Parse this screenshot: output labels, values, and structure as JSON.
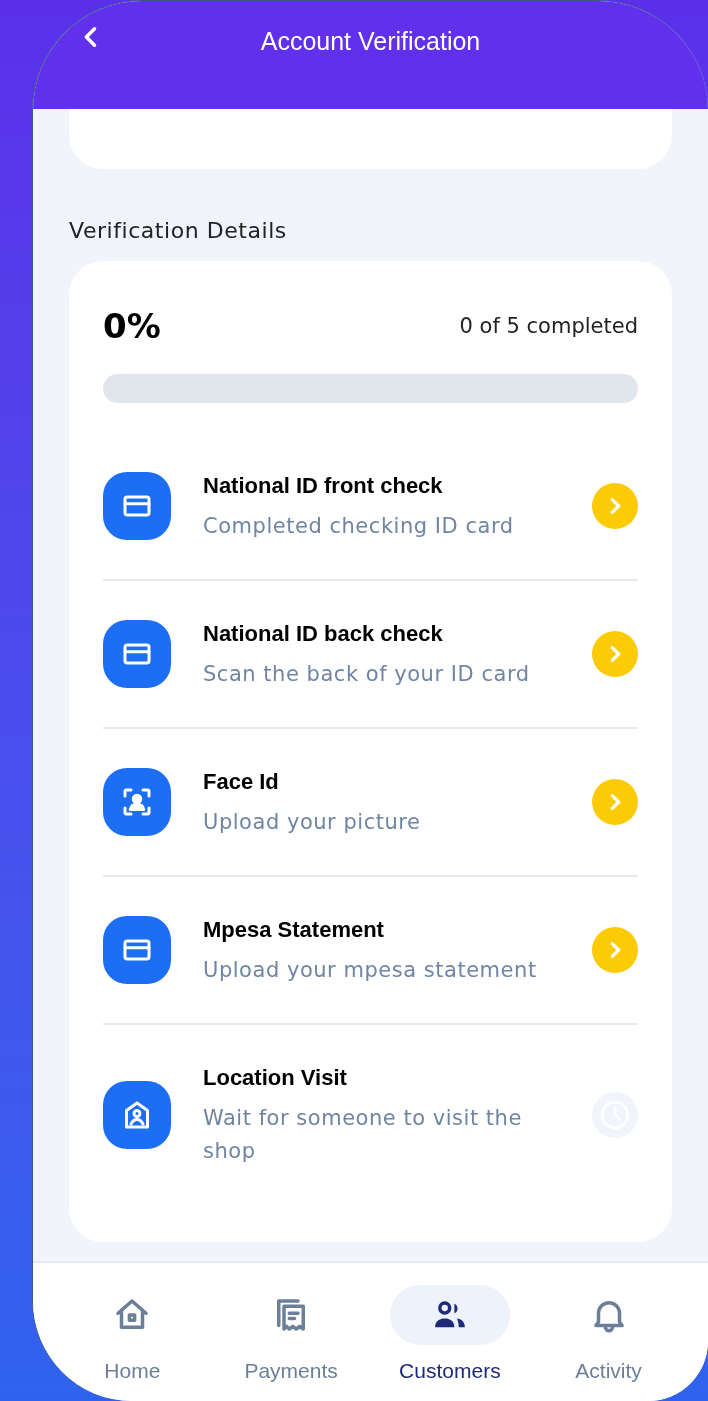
{
  "header": {
    "title": "Account Verification"
  },
  "section_title": "Verification Details",
  "progress": {
    "percent": "0%",
    "summary": "0 of 5 completed",
    "level": 0
  },
  "steps": [
    {
      "kind": "action",
      "title": "National ID front check",
      "subtitle": "Completed checking ID card"
    },
    {
      "kind": "action",
      "title": "National ID back check",
      "subtitle": "Scan the back of your ID card"
    },
    {
      "kind": "action",
      "title": "Face Id",
      "subtitle": "Upload your picture"
    },
    {
      "kind": "action",
      "title": "Mpesa Statement",
      "subtitle": "Upload your mpesa statement"
    },
    {
      "kind": "pending",
      "title": "Location Visit",
      "subtitle": "Wait for someone to visit the shop"
    }
  ],
  "nav": [
    {
      "label": "Home",
      "selected": false
    },
    {
      "label": "Payments",
      "selected": false
    },
    {
      "label": "Customers",
      "selected": true
    },
    {
      "label": "Activity",
      "selected": false
    }
  ]
}
